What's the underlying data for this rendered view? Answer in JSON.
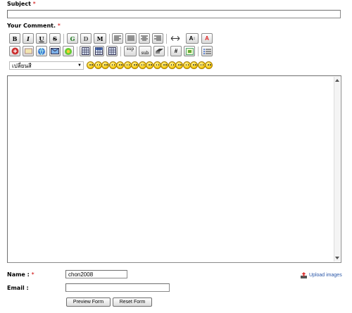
{
  "subject": {
    "label": "Subject",
    "required": "*",
    "value": ""
  },
  "comment": {
    "label": "Your Comment.",
    "required": "*",
    "value": ""
  },
  "toolbar": {
    "row1": [
      "B",
      "I",
      "U",
      "S",
      "G",
      "D",
      "M",
      "left",
      "justify",
      "center",
      "right",
      "width",
      "font-size",
      "A"
    ],
    "row2": [
      "flash",
      "image-box",
      "web",
      "email",
      "image",
      "table",
      "table-2",
      "table-3",
      "sup",
      "sub",
      "quote",
      "#",
      "code",
      "list"
    ],
    "font_select": "เปลี่ยนสี",
    "bold": "B",
    "italic": "I",
    "underline": "U",
    "strike": "S",
    "g": "G",
    "d": "D",
    "m": "M",
    "sup": "sup",
    "sub": "sub",
    "hash": "#",
    "font_a": "A",
    "font_size": "A"
  },
  "smiley_count": 17,
  "name": {
    "label": "Name :",
    "required": "*",
    "value": "chon2008"
  },
  "email": {
    "label": "Email :",
    "value": ""
  },
  "upload": {
    "label": "Upload images"
  },
  "buttons": {
    "preview": "Preview Form",
    "reset": "Reset Form"
  },
  "colors": {
    "required": "#cc0000",
    "link": "#2a57a8"
  }
}
